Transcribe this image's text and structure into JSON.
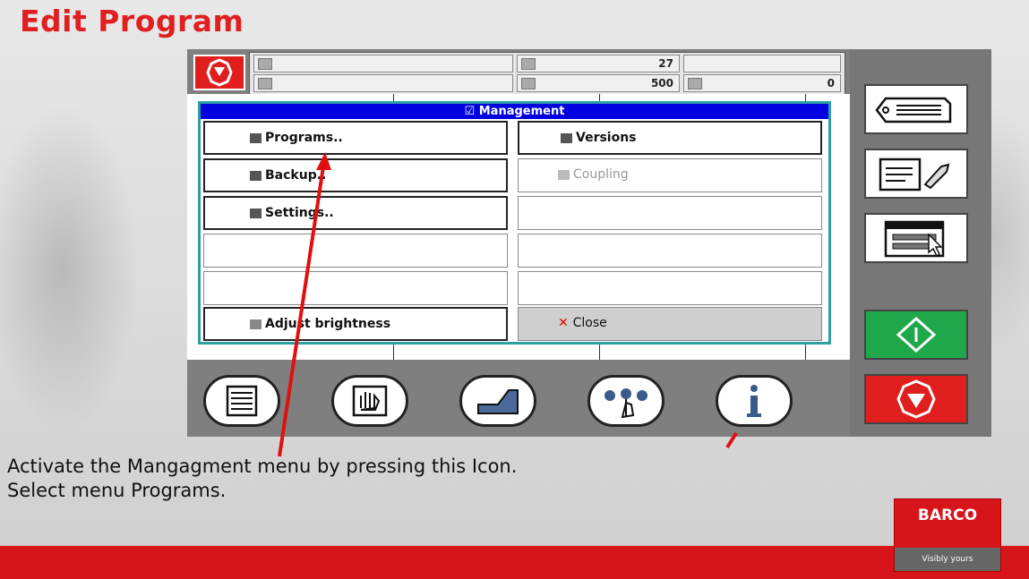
{
  "slide": {
    "title": "Edit Program",
    "caption_line1": "Activate the Mangagment menu by pressing this Icon.",
    "caption_line2": "Select menu Programs.",
    "brand": "BARCO",
    "brand_tagline": "Visibly yours"
  },
  "topbar": {
    "value1": "27",
    "value2": "500",
    "value3": "0"
  },
  "dialog": {
    "title": "Management",
    "items": [
      {
        "label": "Programs..",
        "icon": "programs-icon"
      },
      {
        "label": "Versions",
        "icon": "versions-icon"
      },
      {
        "label": "Backup..",
        "icon": "backup-icon"
      },
      {
        "label": "Coupling",
        "icon": "coupling-icon"
      },
      {
        "label": "Settings..",
        "icon": "settings-icon"
      },
      {
        "label": "Adjust brightness",
        "icon": "brightness-icon"
      },
      {
        "label": "Close",
        "icon": "close-icon"
      }
    ]
  },
  "icons": {
    "right_panel": [
      "tag-icon",
      "edit-tools-icon",
      "menu-cursor-icon",
      "start-icon",
      "stop-icon"
    ],
    "bottom_tools": [
      "list-icon",
      "manual-hand-icon",
      "profile-icon",
      "touch-dots-icon",
      "info-icon"
    ]
  },
  "colors": {
    "accent_red": "#d8141b",
    "title_blue": "#0000e0",
    "start_green": "#1fa84a"
  }
}
